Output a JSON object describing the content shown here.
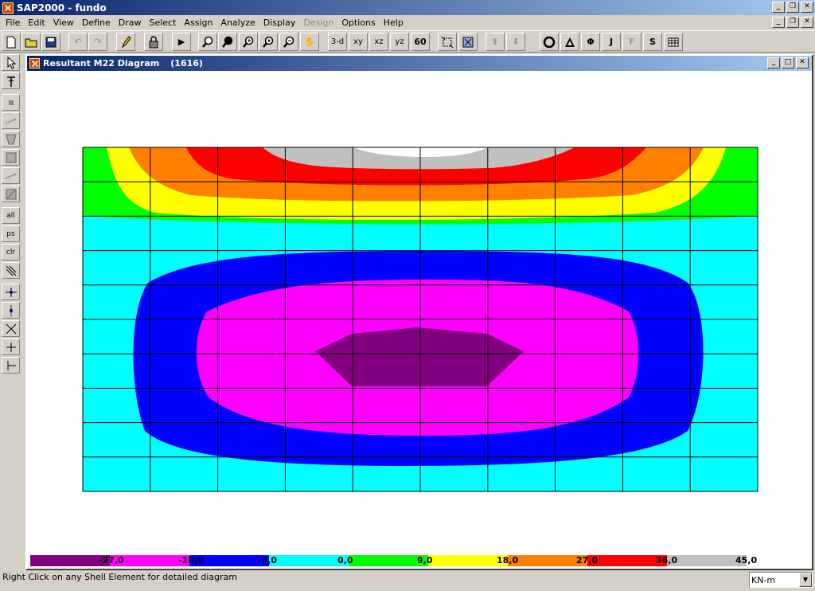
{
  "app": {
    "title": "SAP2000 - fundo"
  },
  "menu": [
    "File",
    "Edit",
    "View",
    "Define",
    "Draw",
    "Select",
    "Assign",
    "Analyze",
    "Display",
    "Design",
    "Options",
    "Help"
  ],
  "toolbar": {
    "buttons": [
      "new-icon",
      "open-icon",
      "save-icon",
      "undo-icon",
      "redo-icon",
      "pencil-icon",
      "lock-icon",
      "run-icon",
      "zoom-window-icon",
      "zoom-icon",
      "zoom-in-icon",
      "zoom-out-icon",
      "zoom-prev-icon",
      "pan-icon"
    ],
    "view_buttons": [
      "3-d",
      "xy",
      "xz",
      "yz"
    ],
    "end_letters": [
      "J",
      "F",
      "S"
    ]
  },
  "window": {
    "title": "Resultant M22 Diagram",
    "subtitle": "(1616)"
  },
  "colors": {
    "purple": "#800080",
    "magenta": "#ff00ff",
    "blue": "#0000ff",
    "cyan": "#00ffff",
    "green": "#00ff00",
    "yellow": "#ffff00",
    "orange": "#ff8000",
    "red": "#ff0000",
    "gray": "#c0c0c0"
  },
  "scale_labels": [
    "-27,0",
    "-18,0",
    "-9,0",
    "0,0",
    "9,0",
    "18,0",
    "27,0",
    "36,0",
    "45,0"
  ],
  "status": {
    "text": "Right Click on any Shell Element for detailed diagram",
    "units": "KN-m"
  }
}
